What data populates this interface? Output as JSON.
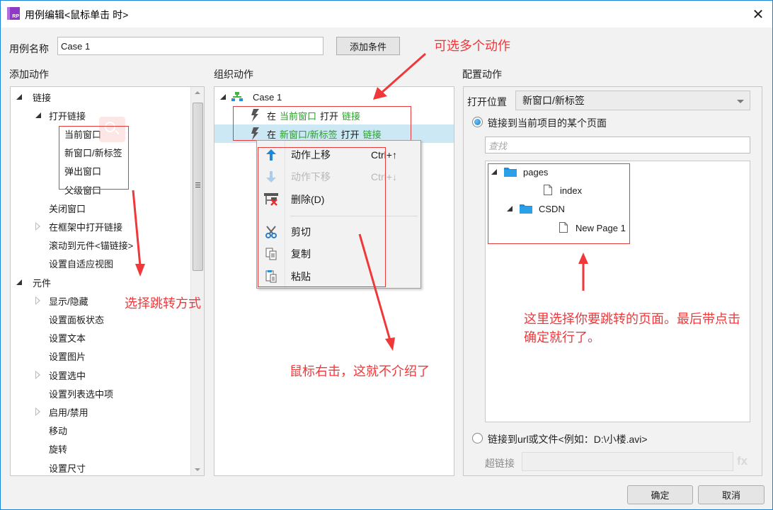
{
  "window": {
    "title": "用例编辑<鼠标单击 时>",
    "app_icon_text": "RP",
    "close_glyph": "✕"
  },
  "case_name": {
    "label": "用例名称",
    "value": "Case 1",
    "add_condition_button": "添加条件"
  },
  "add_actions": {
    "heading": "添加动作",
    "items": [
      {
        "label": "链接",
        "level": 0,
        "toggle": "open"
      },
      {
        "label": "打开链接",
        "level": 1,
        "toggle": "open"
      },
      {
        "label": "当前窗口",
        "level": 2,
        "toggle": "none"
      },
      {
        "label": "新窗口/新标签",
        "level": 2,
        "toggle": "none"
      },
      {
        "label": "弹出窗口",
        "level": 2,
        "toggle": "none"
      },
      {
        "label": "父级窗口",
        "level": 2,
        "toggle": "none"
      },
      {
        "label": "关闭窗口",
        "level": 1,
        "toggle": "none"
      },
      {
        "label": "在框架中打开链接",
        "level": 1,
        "toggle": "closed"
      },
      {
        "label": "滚动到元件<锚链接>",
        "level": 1,
        "toggle": "none"
      },
      {
        "label": "设置自适应视图",
        "level": 1,
        "toggle": "none"
      },
      {
        "label": "元件",
        "level": 0,
        "toggle": "open"
      },
      {
        "label": "显示/隐藏",
        "level": 1,
        "toggle": "closed"
      },
      {
        "label": "设置面板状态",
        "level": 1,
        "toggle": "none"
      },
      {
        "label": "设置文本",
        "level": 1,
        "toggle": "none"
      },
      {
        "label": "设置图片",
        "level": 1,
        "toggle": "none"
      },
      {
        "label": "设置选中",
        "level": 1,
        "toggle": "closed"
      },
      {
        "label": "设置列表选中项",
        "level": 1,
        "toggle": "none"
      },
      {
        "label": "启用/禁用",
        "level": 1,
        "toggle": "closed"
      },
      {
        "label": "移动",
        "level": 1,
        "toggle": "none"
      },
      {
        "label": "旋转",
        "level": 1,
        "toggle": "none"
      },
      {
        "label": "设置尺寸",
        "level": 1,
        "toggle": "none"
      }
    ]
  },
  "organize_actions": {
    "heading": "组织动作",
    "case_label": "Case 1",
    "actions": [
      {
        "prefix": "在",
        "target": "当前窗口",
        "verb": "打开",
        "object": "链接",
        "selected": false
      },
      {
        "prefix": "在",
        "target": "新窗口/新标签",
        "verb": "打开",
        "object": "链接",
        "selected": true
      }
    ]
  },
  "context_menu": {
    "items": [
      {
        "label": "动作上移",
        "shortcut": "Ctrl+↑",
        "icon": "arrow-up-icon",
        "disabled": false
      },
      {
        "label": "动作下移",
        "shortcut": "Ctrl+↓",
        "icon": "arrow-down-icon",
        "disabled": true
      },
      {
        "label": "删除(D)",
        "shortcut": "",
        "icon": "delete-icon",
        "disabled": false
      },
      {
        "label": "剪切",
        "shortcut": "",
        "icon": "scissors-icon",
        "disabled": false
      },
      {
        "label": "复制",
        "shortcut": "",
        "icon": "copy-icon",
        "disabled": false
      },
      {
        "label": "粘贴",
        "shortcut": "",
        "icon": "paste-icon",
        "disabled": false
      }
    ]
  },
  "configure_action": {
    "heading": "配置动作",
    "open_location_label": "打开位置",
    "open_location_value": "新窗口/新标签",
    "radio_page_label": "链接到当前项目的某个页面",
    "radio_page_checked": true,
    "search_placeholder": "查找",
    "pages_tree": [
      {
        "label": "pages",
        "type": "folder",
        "level": 0
      },
      {
        "label": "index",
        "type": "page",
        "level": 1
      },
      {
        "label": "CSDN",
        "type": "folder",
        "level": 1
      },
      {
        "label": "New Page 1",
        "type": "page",
        "level": 2
      }
    ],
    "radio_url_label": "链接到url或文件<例如：D:\\小楼.avi>",
    "radio_url_checked": false,
    "hyperlink_label": "超链接",
    "hyperlink_value": "",
    "fx_label": "fx"
  },
  "footer": {
    "ok_button": "确定",
    "cancel_button": "取消"
  },
  "annotations": {
    "multi_select": "可选多个动作",
    "choose_jump": "选择跳转方式",
    "right_click": "鼠标右击，这就不介绍了",
    "choose_page_line1": "这里选择你要跳转的页面。最后带点击",
    "choose_page_line2": "确定就行了。"
  },
  "colors": {
    "annotation_red": "#f0383b",
    "action_green": "#27a227",
    "selection_blue": "#cce8f4",
    "window_border": "#1883d7"
  }
}
